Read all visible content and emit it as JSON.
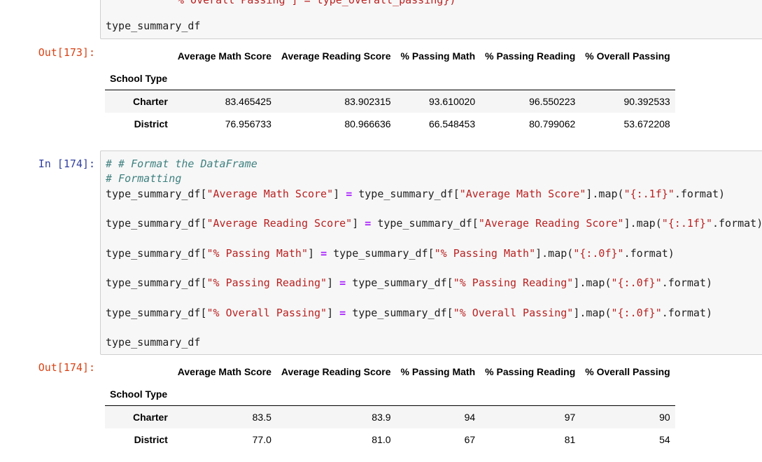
{
  "cell_173": {
    "code_lines": [
      {
        "id": "cut",
        "html": "<span class='tok-str'>% Overall Passing</span>] = type_overall_passing})"
      },
      {
        "id": "last",
        "text": "type_summary_df"
      }
    ],
    "out_prompt": "Out[173]:",
    "table": {
      "columns": [
        "Average Math Score",
        "Average Reading Score",
        "% Passing Math",
        "% Passing Reading",
        "% Overall Passing"
      ],
      "index_name": "School Type",
      "rows": [
        {
          "label": "Charter",
          "values": [
            "83.465425",
            "83.902315",
            "93.610020",
            "96.550223",
            "90.392533"
          ]
        },
        {
          "label": "District",
          "values": [
            "76.956733",
            "80.966636",
            "66.548453",
            "80.799062",
            "53.672208"
          ]
        }
      ]
    }
  },
  "cell_174": {
    "in_prompt": "In [174]:",
    "comment_1": "# # Format the DataFrame",
    "comment_2": "# Formatting",
    "lines": [
      {
        "lhs_name": "type_summary_df[",
        "key": "\"Average Math Score\"",
        "rhs_name": "type_summary_df[",
        "fmt": "\"{:.1f}\"",
        "tail": ".format)"
      },
      {
        "lhs_name": "type_summary_df[",
        "key": "\"Average Reading Score\"",
        "rhs_name": "type_summary_df[",
        "fmt": "\"{:.1f}\"",
        "tail": ".format)"
      },
      {
        "lhs_name": "type_summary_df[",
        "key": "\"% Passing Math\"",
        "rhs_name": "type_summary_df[",
        "fmt": "\"{:.0f}\"",
        "tail": ".format)"
      },
      {
        "lhs_name": "type_summary_df[",
        "key": "\"% Passing Reading\"",
        "rhs_name": "type_summary_df[",
        "fmt": "\"{:.0f}\"",
        "tail": ".format)"
      },
      {
        "lhs_name": "type_summary_df[",
        "key": "\"% Overall Passing\"",
        "rhs_name": "type_summary_df[",
        "fmt": "\"{:.0f}\"",
        "tail": ".format)"
      }
    ],
    "last_line": "type_summary_df",
    "out_prompt": "Out[174]:",
    "table": {
      "columns": [
        "Average Math Score",
        "Average Reading Score",
        "% Passing Math",
        "% Passing Reading",
        "% Overall Passing"
      ],
      "index_name": "School Type",
      "rows": [
        {
          "label": "Charter",
          "values": [
            "83.5",
            "83.9",
            "94",
            "97",
            "90"
          ]
        },
        {
          "label": "District",
          "values": [
            "77.0",
            "81.0",
            "67",
            "81",
            "54"
          ]
        }
      ]
    }
  }
}
